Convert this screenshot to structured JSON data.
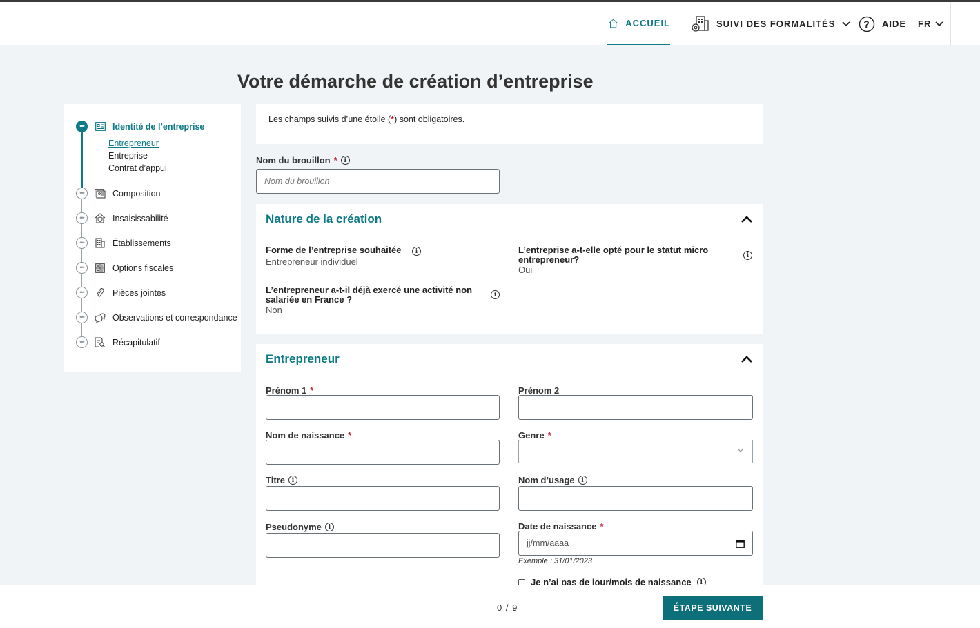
{
  "header": {
    "home_label": "ACCUEIL",
    "suivi_label": "SUIVI DES FORMALITÉS",
    "aide_label": "AIDE",
    "lang_label": "FR"
  },
  "page_title": "Votre démarche de création d’entreprise",
  "sidebar": {
    "steps": [
      {
        "label": "Identité de l’entreprise",
        "icon": "id-card-icon",
        "active": true
      },
      {
        "label": "Composition",
        "icon": "composition-icon"
      },
      {
        "label": "Insaisissabilité",
        "icon": "house-shield-icon"
      },
      {
        "label": "Établissements",
        "icon": "building-icon"
      },
      {
        "label": "Options fiscales",
        "icon": "calculator-icon"
      },
      {
        "label": "Pièces jointes",
        "icon": "paperclip-icon"
      },
      {
        "label": "Observations et correspondance",
        "icon": "chat-icon"
      },
      {
        "label": "Récapitulatif",
        "icon": "document-search-icon"
      }
    ],
    "substeps": [
      {
        "label": "Entrepreneur",
        "active": true
      },
      {
        "label": "Entreprise"
      },
      {
        "label": "Contrat d’appui"
      }
    ]
  },
  "notice": {
    "before": "Les champs suivis d’une étoile (",
    "star": "*",
    "after": ") sont obligatoires."
  },
  "draft": {
    "label": "Nom du brouillon",
    "placeholder": "Nom du brouillon"
  },
  "nature": {
    "title": "Nature de la création",
    "forme_label": "Forme de l’entreprise souhaitée",
    "forme_value": "Entrepreneur individuel",
    "micro_label": "L’entreprise a-t-elle opté pour le statut micro entrepreneur?",
    "micro_value": "Oui",
    "deja_label": "L’entrepreneur a-t-il déjà exercé une activité non salariée en France ?",
    "deja_value": "Non"
  },
  "entrepreneur": {
    "title": "Entrepreneur",
    "prenom1_label": "Prénom 1",
    "prenom2_label": "Prénom 2",
    "nom_naissance_label": "Nom de naissance",
    "genre_label": "Genre",
    "titre_label": "Titre",
    "nom_usage_label": "Nom d’usage",
    "pseudonyme_label": "Pseudonyme",
    "date_naissance_label": "Date de naissance",
    "date_placeholder": "jj/mm/aaaa",
    "date_hint": "Exemple : 31/01/2023",
    "no_date_label": "Je n’ai pas de jour/mois de naissance",
    "required_star": "*"
  },
  "footer": {
    "pager": "0 / 9",
    "next_label": "ÉTAPE SUIVANTE"
  },
  "colors": {
    "accent": "#0d7a86",
    "required": "#c0142b",
    "button": "#0d6f7a"
  }
}
